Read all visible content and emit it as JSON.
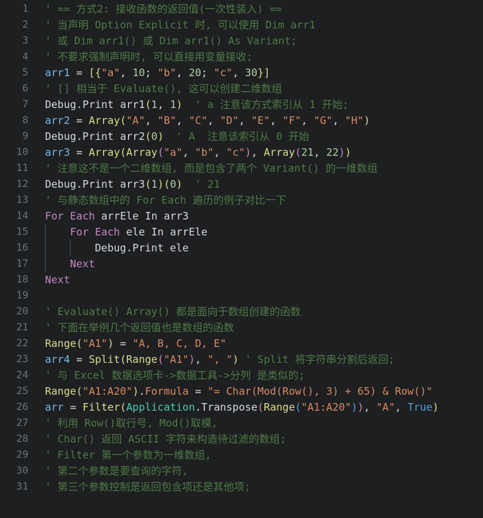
{
  "editor": {
    "name": "code-editor",
    "background": "#1d1f21",
    "gutter_color": "#6b7378",
    "font_size_px": 15,
    "line_height_px": 23,
    "language": "VBA",
    "colors": {
      "comment": "#4f7a45",
      "variable": "#7ab8e6",
      "function": "#dcdc8d",
      "string": "#d98a63",
      "number": "#b4cea8",
      "keyword": "#c586c0",
      "type": "#4ec9b0",
      "boolean": "#569cd6",
      "plain": "#d6d9dd",
      "indent_guide": "#4a4f54"
    }
  },
  "lines": [
    {
      "n": "1",
      "indent": 0,
      "text": "' == 方式2: 接收函数的返回值(一次性装入) =="
    },
    {
      "n": "2",
      "indent": 0,
      "text": "' 当声明 Option Explicit 时, 可以使用 Dim arr1"
    },
    {
      "n": "3",
      "indent": 0,
      "text": "' 或 Dim arr1() 或 Dim arr1() As Variant;"
    },
    {
      "n": "4",
      "indent": 0,
      "text": "' 不要求强制声明时, 可以直接用变量接收;"
    },
    {
      "n": "5",
      "indent": 0,
      "text": "arr1 = [{\"a\", 10; \"b\", 20; \"c\", 30}]"
    },
    {
      "n": "6",
      "indent": 0,
      "text": "' [] 相当于 Evaluate(), 这可以创建二维数组"
    },
    {
      "n": "7",
      "indent": 0,
      "text": "Debug.Print arr1(1, 1)  ' a 注意该方式索引从 1 开始;"
    },
    {
      "n": "8",
      "indent": 0,
      "text": "arr2 = Array(\"A\", \"B\", \"C\", \"D\", \"E\", \"F\", \"G\", \"H\")"
    },
    {
      "n": "9",
      "indent": 0,
      "text": "Debug.Print arr2(0)  ' A  注意该索引从 0 开始"
    },
    {
      "n": "10",
      "indent": 0,
      "text": "arr3 = Array(Array(\"a\", \"b\", \"c\"), Array(21, 22))"
    },
    {
      "n": "11",
      "indent": 0,
      "text": "' 注意这不是一个二维数组, 而是包含了两个 Variant() 的一维数组"
    },
    {
      "n": "12",
      "indent": 0,
      "text": "Debug.Print arr3(1)(0)  ' 21"
    },
    {
      "n": "13",
      "indent": 0,
      "text": "' 与静态数组中的 For Each 遍历的例子对比一下"
    },
    {
      "n": "14",
      "indent": 0,
      "text": "For Each arrEle In arr3"
    },
    {
      "n": "15",
      "indent": 1,
      "text": "For Each ele In arrEle"
    },
    {
      "n": "16",
      "indent": 2,
      "text": "Debug.Print ele"
    },
    {
      "n": "17",
      "indent": 1,
      "text": "Next"
    },
    {
      "n": "18",
      "indent": 0,
      "text": "Next"
    },
    {
      "n": "19",
      "indent": 0,
      "text": ""
    },
    {
      "n": "20",
      "indent": 0,
      "text": "' Evaluate() Array() 都是面向于数组创建的函数"
    },
    {
      "n": "21",
      "indent": 0,
      "text": "' 下面在举例几个返回值也是数组的函数"
    },
    {
      "n": "22",
      "indent": 0,
      "text": "Range(\"A1\") = \"A, B, C, D, E\""
    },
    {
      "n": "23",
      "indent": 0,
      "text": "arr4 = Split(Range(\"A1\"), \", \") ' Split 将字符串分割后返回;"
    },
    {
      "n": "24",
      "indent": 0,
      "text": "' 与 Excel 数据选项卡->数据工具->分列 是类似的;"
    },
    {
      "n": "25",
      "indent": 0,
      "text": "Range(\"A1:A20\").Formula = \"= Char(Mod(Row(), 3) + 65) & Row()\""
    },
    {
      "n": "26",
      "indent": 0,
      "text": "arr = Filter(Application.Transpose(Range(\"A1:A20\")), \"A\", True)"
    },
    {
      "n": "27",
      "indent": 0,
      "text": "' 利用 Row()取行号, Mod()取模,"
    },
    {
      "n": "28",
      "indent": 0,
      "text": "' Char() 返回 ASCII 字符来构造待过滤的数组;"
    },
    {
      "n": "29",
      "indent": 0,
      "text": "' Filter 第一个参数为一维数组,"
    },
    {
      "n": "30",
      "indent": 0,
      "text": "' 第二个参数是要查询的字符,"
    },
    {
      "n": "31",
      "indent": 0,
      "text": "' 第三个参数控制是返回包含项还是其他项;"
    }
  ],
  "tokens": [
    [
      {
        "t": "' == 方式2: 接收函数的返回值(一次性装入) ==",
        "c": "comment"
      }
    ],
    [
      {
        "t": "' 当声明 Option Explicit 时, 可以使用 Dim arr1",
        "c": "comment"
      }
    ],
    [
      {
        "t": "' 或 Dim arr1() 或 Dim arr1() As Variant;",
        "c": "comment"
      }
    ],
    [
      {
        "t": "' 不要求强制声明时, 可以直接用变量接收;",
        "c": "comment"
      }
    ],
    [
      {
        "t": "arr1",
        "c": "variable"
      },
      {
        "t": " = ",
        "c": "plain"
      },
      {
        "t": "[{",
        "c": "function"
      },
      {
        "t": "\"a\"",
        "c": "string"
      },
      {
        "t": ", ",
        "c": "plain"
      },
      {
        "t": "10",
        "c": "number"
      },
      {
        "t": "; ",
        "c": "plain"
      },
      {
        "t": "\"b\"",
        "c": "string"
      },
      {
        "t": ", ",
        "c": "plain"
      },
      {
        "t": "20",
        "c": "number"
      },
      {
        "t": "; ",
        "c": "plain"
      },
      {
        "t": "\"c\"",
        "c": "string"
      },
      {
        "t": ", ",
        "c": "plain"
      },
      {
        "t": "30",
        "c": "number"
      },
      {
        "t": "}]",
        "c": "function"
      }
    ],
    [
      {
        "t": "' [] 相当于 Evaluate(), 这可以创建二维数组",
        "c": "comment"
      }
    ],
    [
      {
        "t": "Debug",
        "c": "plain"
      },
      {
        "t": ".",
        "c": "plain"
      },
      {
        "t": "Print",
        "c": "plain"
      },
      {
        "t": " arr1",
        "c": "plain"
      },
      {
        "t": "(",
        "c": "function"
      },
      {
        "t": "1",
        "c": "number"
      },
      {
        "t": ", ",
        "c": "plain"
      },
      {
        "t": "1",
        "c": "number"
      },
      {
        "t": ")",
        "c": "function"
      },
      {
        "t": "  ",
        "c": "plain"
      },
      {
        "t": "' a 注意该方式索引从 1 开始;",
        "c": "comment"
      }
    ],
    [
      {
        "t": "arr2",
        "c": "variable"
      },
      {
        "t": " = ",
        "c": "plain"
      },
      {
        "t": "Array",
        "c": "function"
      },
      {
        "t": "(",
        "c": "function"
      },
      {
        "t": "\"A\"",
        "c": "string"
      },
      {
        "t": ", ",
        "c": "plain"
      },
      {
        "t": "\"B\"",
        "c": "string"
      },
      {
        "t": ", ",
        "c": "plain"
      },
      {
        "t": "\"C\"",
        "c": "string"
      },
      {
        "t": ", ",
        "c": "plain"
      },
      {
        "t": "\"D\"",
        "c": "string"
      },
      {
        "t": ", ",
        "c": "plain"
      },
      {
        "t": "\"E\"",
        "c": "string"
      },
      {
        "t": ", ",
        "c": "plain"
      },
      {
        "t": "\"F\"",
        "c": "string"
      },
      {
        "t": ", ",
        "c": "plain"
      },
      {
        "t": "\"G\"",
        "c": "string"
      },
      {
        "t": ", ",
        "c": "plain"
      },
      {
        "t": "\"H\"",
        "c": "string"
      },
      {
        "t": ")",
        "c": "function"
      }
    ],
    [
      {
        "t": "Debug.Print arr2",
        "c": "plain"
      },
      {
        "t": "(",
        "c": "function"
      },
      {
        "t": "0",
        "c": "number"
      },
      {
        "t": ")",
        "c": "function"
      },
      {
        "t": "  ",
        "c": "plain"
      },
      {
        "t": "' A  注意该索引从 0 开始",
        "c": "comment"
      }
    ],
    [
      {
        "t": "arr3",
        "c": "variable"
      },
      {
        "t": " = ",
        "c": "plain"
      },
      {
        "t": "Array",
        "c": "function"
      },
      {
        "t": "(",
        "c": "function"
      },
      {
        "t": "Array",
        "c": "function"
      },
      {
        "t": "(",
        "c": "keyword"
      },
      {
        "t": "\"a\"",
        "c": "string"
      },
      {
        "t": ", ",
        "c": "plain"
      },
      {
        "t": "\"b\"",
        "c": "string"
      },
      {
        "t": ", ",
        "c": "plain"
      },
      {
        "t": "\"c\"",
        "c": "string"
      },
      {
        "t": ")",
        "c": "keyword"
      },
      {
        "t": ", ",
        "c": "plain"
      },
      {
        "t": "Array",
        "c": "function"
      },
      {
        "t": "(",
        "c": "keyword"
      },
      {
        "t": "21",
        "c": "number"
      },
      {
        "t": ", ",
        "c": "plain"
      },
      {
        "t": "22",
        "c": "number"
      },
      {
        "t": ")",
        "c": "keyword"
      },
      {
        "t": ")",
        "c": "function"
      }
    ],
    [
      {
        "t": "' 注意这不是一个二维数组, 而是包含了两个 Variant() 的一维数组",
        "c": "comment"
      }
    ],
    [
      {
        "t": "Debug.Print arr3",
        "c": "plain"
      },
      {
        "t": "(",
        "c": "function"
      },
      {
        "t": "1",
        "c": "number"
      },
      {
        "t": ")",
        "c": "function"
      },
      {
        "t": "(",
        "c": "function"
      },
      {
        "t": "0",
        "c": "number"
      },
      {
        "t": ")",
        "c": "function"
      },
      {
        "t": "  ",
        "c": "plain"
      },
      {
        "t": "' 21",
        "c": "comment"
      }
    ],
    [
      {
        "t": "' 与静态数组中的 For Each 遍历的例子对比一下",
        "c": "comment"
      }
    ],
    [
      {
        "t": "For",
        "c": "keyword"
      },
      {
        "t": " ",
        "c": "plain"
      },
      {
        "t": "Each",
        "c": "keyword"
      },
      {
        "t": " arrEle ",
        "c": "plain"
      },
      {
        "t": "In",
        "c": "plain"
      },
      {
        "t": " arr3",
        "c": "plain"
      }
    ],
    [
      {
        "t": "For",
        "c": "keyword"
      },
      {
        "t": " ",
        "c": "plain"
      },
      {
        "t": "Each",
        "c": "keyword"
      },
      {
        "t": " ele ",
        "c": "plain"
      },
      {
        "t": "In",
        "c": "plain"
      },
      {
        "t": " arrEle",
        "c": "plain"
      }
    ],
    [
      {
        "t": "Debug.Print ele",
        "c": "plain"
      }
    ],
    [
      {
        "t": "Next",
        "c": "keyword"
      }
    ],
    [
      {
        "t": "Next",
        "c": "keyword"
      }
    ],
    [],
    [
      {
        "t": "' Evaluate() Array() 都是面向于数组创建的函数",
        "c": "comment"
      }
    ],
    [
      {
        "t": "' 下面在举例几个返回值也是数组的函数",
        "c": "comment"
      }
    ],
    [
      {
        "t": "Range",
        "c": "function"
      },
      {
        "t": "(",
        "c": "function"
      },
      {
        "t": "\"A1\"",
        "c": "string"
      },
      {
        "t": ")",
        "c": "function"
      },
      {
        "t": " = ",
        "c": "plain"
      },
      {
        "t": "\"A, B, C, D, E\"",
        "c": "string"
      }
    ],
    [
      {
        "t": "arr4",
        "c": "variable"
      },
      {
        "t": " = ",
        "c": "plain"
      },
      {
        "t": "Split",
        "c": "function"
      },
      {
        "t": "(",
        "c": "function"
      },
      {
        "t": "Range",
        "c": "function"
      },
      {
        "t": "(",
        "c": "keyword"
      },
      {
        "t": "\"A1\"",
        "c": "string"
      },
      {
        "t": ")",
        "c": "keyword"
      },
      {
        "t": ", ",
        "c": "plain"
      },
      {
        "t": "\", \"",
        "c": "string"
      },
      {
        "t": ")",
        "c": "function"
      },
      {
        "t": " ",
        "c": "plain"
      },
      {
        "t": "' Split 将字符串分割后返回;",
        "c": "comment"
      }
    ],
    [
      {
        "t": "' 与 Excel 数据选项卡->数据工具->分列 是类似的;",
        "c": "comment"
      }
    ],
    [
      {
        "t": "Range",
        "c": "function"
      },
      {
        "t": "(",
        "c": "function"
      },
      {
        "t": "\"A1:A20\"",
        "c": "string"
      },
      {
        "t": ")",
        "c": "function"
      },
      {
        "t": ".",
        "c": "plain"
      },
      {
        "t": "Formula",
        "c": "string"
      },
      {
        "t": " = ",
        "c": "plain"
      },
      {
        "t": "\"= Char(Mod(Row(), 3) + 65) & Row()\"",
        "c": "string"
      }
    ],
    [
      {
        "t": "arr",
        "c": "variable"
      },
      {
        "t": " = ",
        "c": "plain"
      },
      {
        "t": "Filter",
        "c": "function"
      },
      {
        "t": "(",
        "c": "function"
      },
      {
        "t": "Application",
        "c": "type"
      },
      {
        "t": ".",
        "c": "plain"
      },
      {
        "t": "Transpose",
        "c": "plain"
      },
      {
        "t": "(",
        "c": "keyword"
      },
      {
        "t": "Range",
        "c": "function"
      },
      {
        "t": "(",
        "c": "boolean"
      },
      {
        "t": "\"A1:A20\"",
        "c": "string"
      },
      {
        "t": ")",
        "c": "boolean"
      },
      {
        "t": ")",
        "c": "keyword"
      },
      {
        "t": ", ",
        "c": "plain"
      },
      {
        "t": "\"A\"",
        "c": "string"
      },
      {
        "t": ", ",
        "c": "plain"
      },
      {
        "t": "True",
        "c": "boolean"
      },
      {
        "t": ")",
        "c": "function"
      }
    ],
    [
      {
        "t": "' 利用 Row()取行号, Mod()取模,",
        "c": "comment"
      }
    ],
    [
      {
        "t": "' Char() 返回 ASCII 字符来构造待过滤的数组;",
        "c": "comment"
      }
    ],
    [
      {
        "t": "' Filter 第一个参数为一维数组,",
        "c": "comment"
      }
    ],
    [
      {
        "t": "' 第二个参数是要查询的字符,",
        "c": "comment"
      }
    ],
    [
      {
        "t": "' 第三个参数控制是返回包含项还是其他项;",
        "c": "comment"
      }
    ]
  ]
}
